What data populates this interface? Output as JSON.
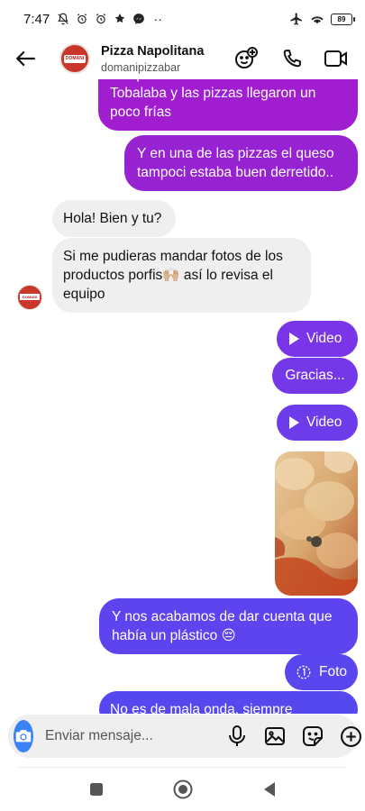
{
  "status_bar": {
    "time": "7:47",
    "battery": "89",
    "icons": [
      "mute-bell-icon",
      "alarm-icon",
      "alarm-icon",
      "notification-icon",
      "messenger-icon",
      "more-dots-icon",
      "airplane-icon",
      "wifi-icon",
      "battery-icon"
    ]
  },
  "header": {
    "contact_name": "Pizza Napolitana",
    "contact_handle": "domanipizzabar",
    "avatar_text": "DOMANI",
    "actions": [
      "add-emoji-icon",
      "phone-icon",
      "video-call-icon"
    ]
  },
  "messages": [
    {
      "id": "m1",
      "direction": "out",
      "type": "text",
      "text": "dos pizzas a domicilio en el local de Tobalaba y las pizzas llegaron un poco frías"
    },
    {
      "id": "m2",
      "direction": "out",
      "type": "text",
      "text": "Y en una de las pizzas el queso tampoci estaba buen derretido.."
    },
    {
      "id": "m3",
      "direction": "in",
      "type": "text",
      "text": "Hola! Bien y tu?"
    },
    {
      "id": "m4",
      "direction": "in",
      "type": "text",
      "text": "Si me pudieras mandar fotos de los productos porfis🙌🏼 así lo revisa el equipo"
    },
    {
      "id": "m5",
      "direction": "out",
      "type": "video",
      "text": "Video"
    },
    {
      "id": "m6",
      "direction": "out",
      "type": "text",
      "text": "Gracias..."
    },
    {
      "id": "m7",
      "direction": "out",
      "type": "video",
      "text": "Video"
    },
    {
      "id": "m8",
      "direction": "out",
      "type": "photo",
      "text": ""
    },
    {
      "id": "m9",
      "direction": "out",
      "type": "text",
      "text": "Y nos acabamos de dar cuenta que había un plástico 😔"
    },
    {
      "id": "m10",
      "direction": "out",
      "type": "view-once-photo",
      "text": "Foto"
    },
    {
      "id": "m11",
      "direction": "out",
      "type": "text",
      "text": "No es de mala onda, siempre"
    }
  ],
  "composer": {
    "placeholder": "Enviar mensaje...",
    "actions": [
      "microphone-icon",
      "gallery-icon",
      "sticker-icon",
      "add-icon"
    ]
  },
  "nav": [
    "recents-square-icon",
    "home-circle-icon",
    "back-triangle-icon"
  ],
  "colors": {
    "bubble_magenta": "#a11ed0",
    "bubble_purple": "#7a35e8",
    "bubble_indigo": "#5a46ee",
    "incoming": "#efefef",
    "camera_button": "#3b82f6"
  }
}
